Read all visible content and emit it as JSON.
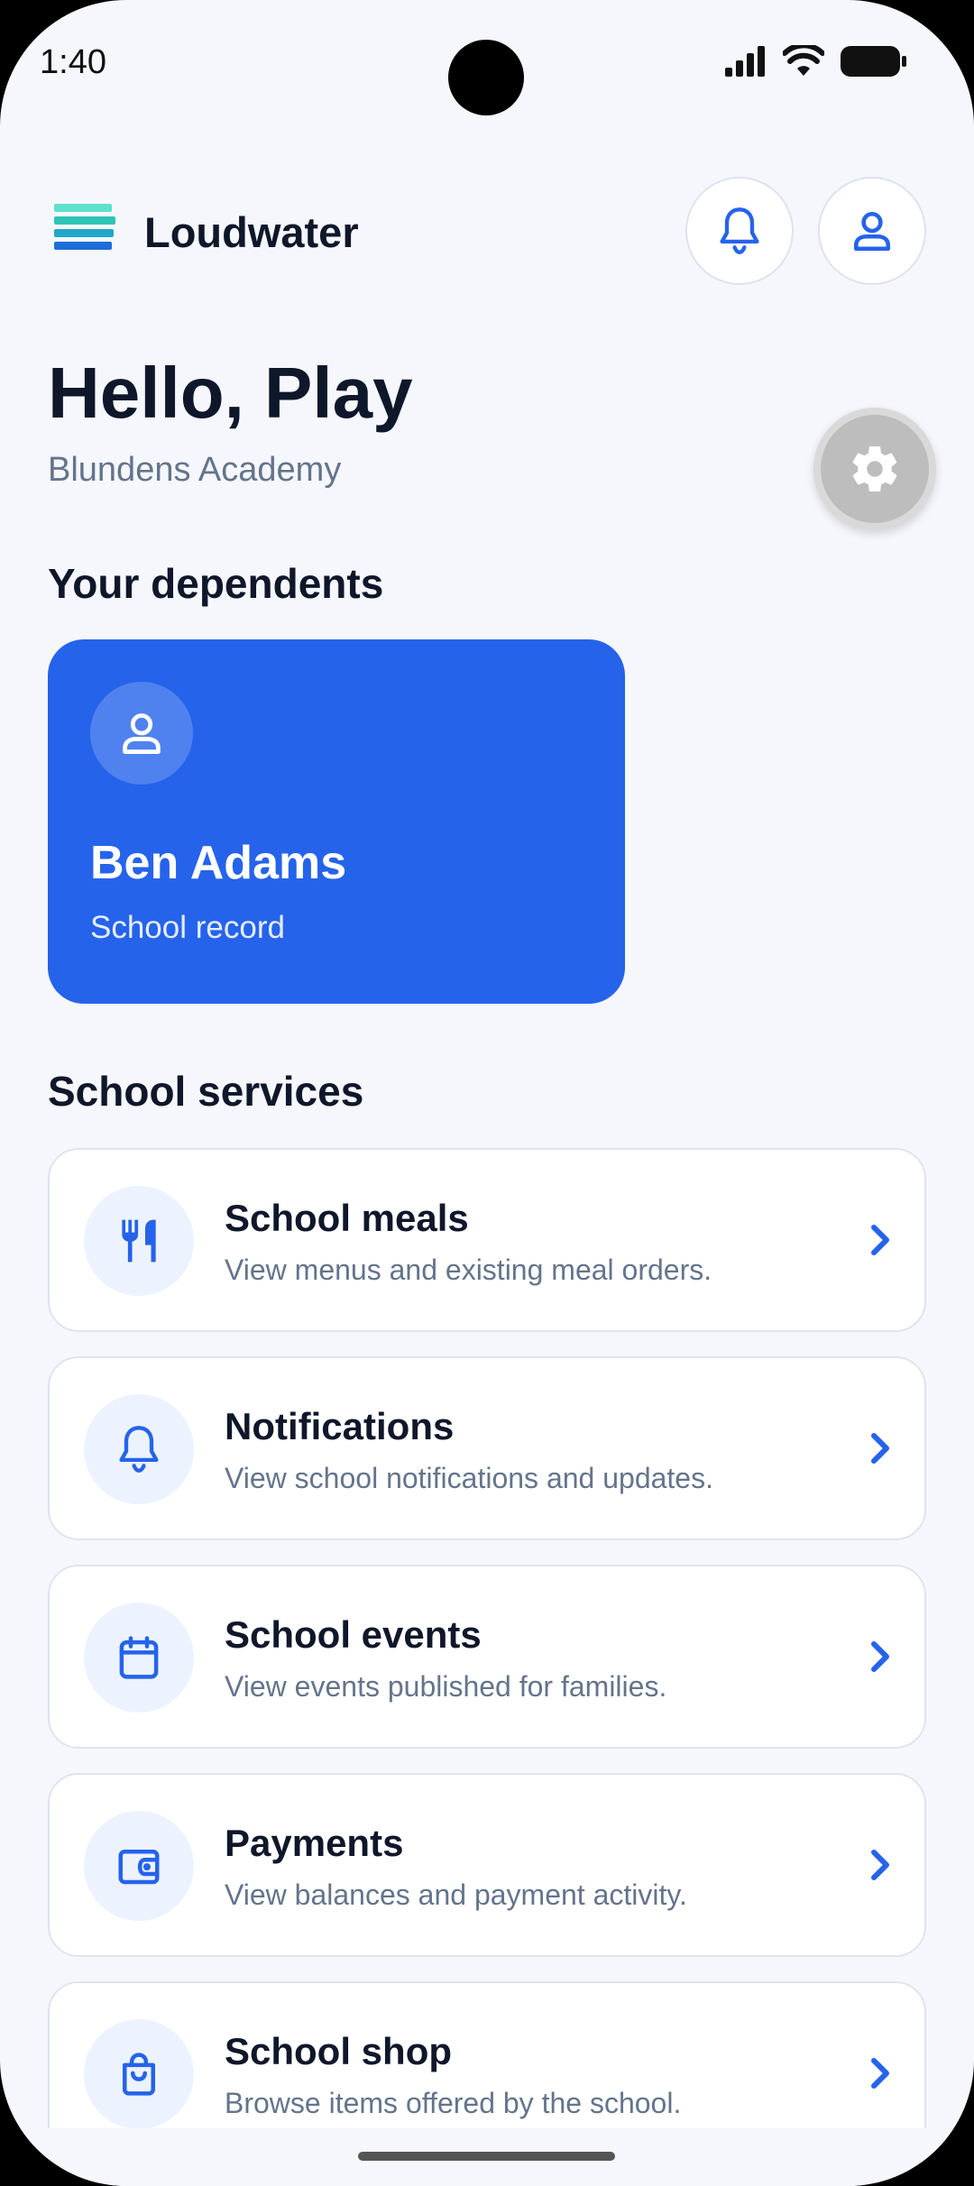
{
  "status_bar": {
    "time": "1:40"
  },
  "header": {
    "title": "Loudwater"
  },
  "greeting": {
    "title": "Hello, Play",
    "school": "Blundens Academy"
  },
  "dependents": {
    "section_title": "Your dependents",
    "items": [
      {
        "name": "Ben Adams",
        "subtitle": "School record"
      }
    ]
  },
  "services": {
    "section_title": "School services",
    "items": [
      {
        "title": "School meals",
        "description": "View menus and existing meal orders.",
        "icon": "cutlery-icon"
      },
      {
        "title": "Notifications",
        "description": "View school notifications and updates.",
        "icon": "bell-icon"
      },
      {
        "title": "School events",
        "description": "View events published for families.",
        "icon": "calendar-icon"
      },
      {
        "title": "Payments",
        "description": "View balances and payment activity.",
        "icon": "wallet-icon"
      },
      {
        "title": "School shop",
        "description": "Browse items offered by the school.",
        "icon": "shopping-bag-icon"
      }
    ]
  },
  "colors": {
    "accent": "#2563eb",
    "background": "#f5f7fc",
    "icon_bg": "#edf3fe"
  }
}
